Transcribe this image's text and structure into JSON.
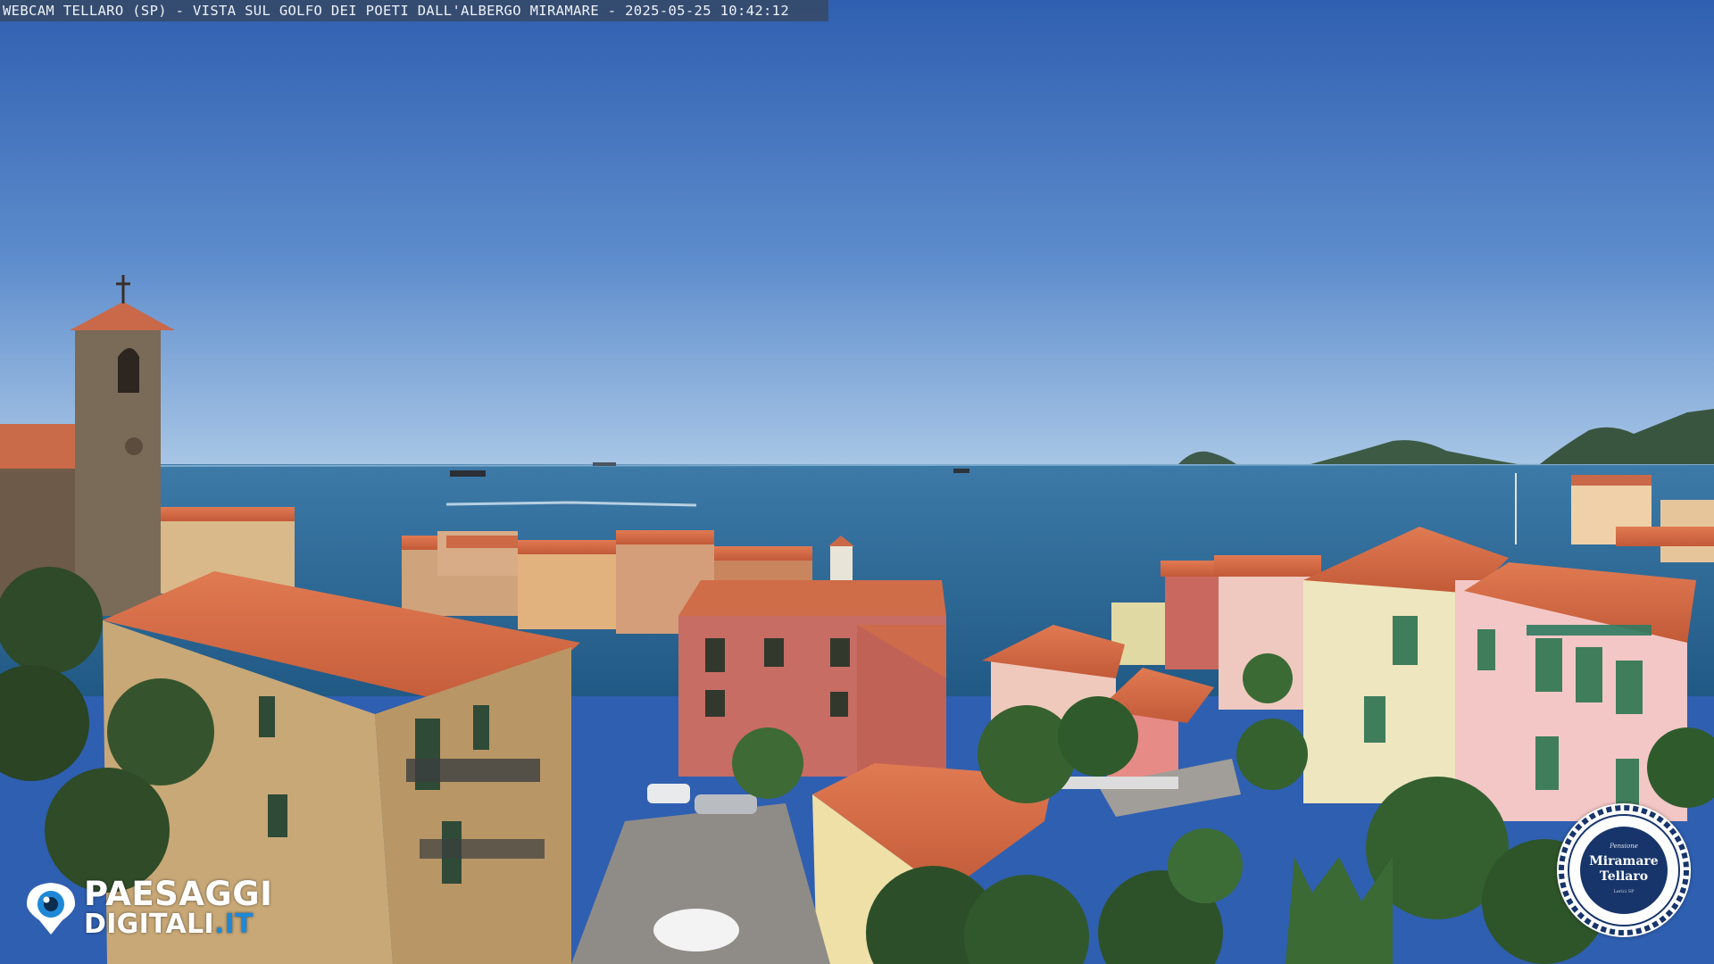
{
  "overlay": {
    "caption": "WEBCAM TELLARO (SP) - VISTA SUL GOLFO DEI POETI DALL'ALBERGO MIRAMARE - 2025-05-25 10:42:12"
  },
  "watermark_left": {
    "line1": "PAESAGGI",
    "line2_main": "DIGITALI",
    "line2_suffix": ".IT",
    "icon": "eye-pin-icon"
  },
  "watermark_right": {
    "small_text": "Pensione",
    "name_line1": "Miramare",
    "name_line2": "Tellaro",
    "tiny_text": "Lerici SP",
    "icon": "rope-seal-logo"
  },
  "colors": {
    "sky_top": "#2f5fb0",
    "sky_horizon": "#a9c7e6",
    "sea": "#2d6a9a",
    "roof_terracotta": "#d76a45",
    "logo_blue": "#1e88d6",
    "seal_navy": "#17356b"
  }
}
